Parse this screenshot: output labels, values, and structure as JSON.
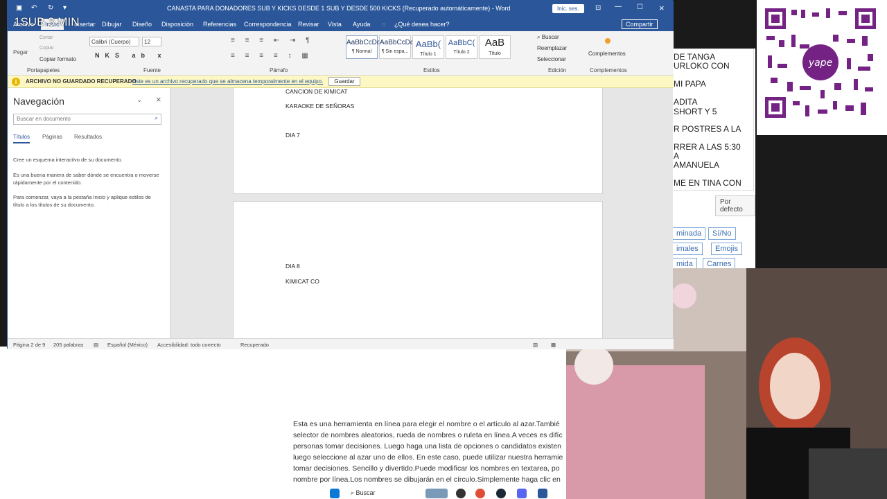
{
  "window": {
    "title": "CANASTA PARA DONADORES SUB Y KICKS DESDE 1 SUB Y DESDE 500 KICKS (Recuperado automáticamente) - Word",
    "signin": "Inic. ses.",
    "share": "Compartir"
  },
  "overlay": {
    "text": "1SUB 3 MIN"
  },
  "tabs": [
    "Archivo",
    "Inicio",
    "Insertar",
    "Dibujar",
    "Diseño",
    "Disposición",
    "Referencias",
    "Correspondencia",
    "Revisar",
    "Vista",
    "Ayuda"
  ],
  "tell_me": "¿Qué desea hacer?",
  "ribbon": {
    "clipboard": {
      "paste": "Pegar",
      "cut": "Cortar",
      "copy": "Copiar",
      "format_painter": "Copiar formato",
      "label": "Portapapeles"
    },
    "font": {
      "name": "Calibri (Cuerpo)",
      "size": "12",
      "label": "Fuente"
    },
    "paragraph": {
      "label": "Párrafo"
    },
    "styles": {
      "items": [
        {
          "preview": "AaBbCcDc",
          "name": "¶ Normal"
        },
        {
          "preview": "AaBbCcDc",
          "name": "¶ Sin espa..."
        },
        {
          "preview": "AaBb(",
          "name": "Título 1"
        },
        {
          "preview": "AaBbC(",
          "name": "Título 2"
        },
        {
          "preview": "AaB",
          "name": "Título"
        }
      ],
      "label": "Estilos"
    },
    "editing": {
      "find": "Buscar",
      "replace": "Reemplazar",
      "select": "Seleccionar",
      "label": "Edición"
    },
    "addins": {
      "button": "Complementos",
      "label": "Complementos"
    }
  },
  "infobar": {
    "heading": "ARCHIVO NO GUARDADO RECUPERADO",
    "message": "Este es un archivo recuperado que se almacena temporalmente en el equipo.",
    "save": "Guardar"
  },
  "nav": {
    "title": "Navegación",
    "search_placeholder": "Buscar en documento",
    "tabs": [
      "Títulos",
      "Páginas",
      "Resultados"
    ],
    "p1": "Cree un esquema interactivo de su documento.",
    "p2": "Es una buena manera de saber dónde se encuentra o moverse rápidamente por el contenido.",
    "p3": "Para comenzar, vaya a la pestaña Inicio y aplique estilos de título a los títulos de su documento."
  },
  "document": {
    "page1": [
      "CANCION DE KIMICAT",
      "KARAOKE DE SEÑORAS",
      "DIA 7"
    ],
    "page2": [
      "DIA 8",
      "KIMICAT CO"
    ]
  },
  "status": {
    "page": "Página 2 de 9",
    "words": "205 palabras",
    "language": "Español (México)",
    "accessibility": "Accesibilidad: todo correcto",
    "recovered": "Recuperado"
  },
  "background_list": [
    "DE TANGA",
    "URLOKO CON",
    "MI PAPA",
    "ADITA",
    "SHORT Y 5",
    "R  POSTRES A  LA",
    "RRER A LAS 5:30",
    "A",
    "AMANUELA",
    "ME EN TINA CON"
  ],
  "background_default": "Por defecto",
  "background_tags": [
    "minada",
    "Sí/No",
    "imales",
    "Emojis",
    "mida",
    "Carnes"
  ],
  "background_paragraph": [
    "Esta es una herramienta en línea para elegir el nombre o el artículo al azar.Tambié",
    "selector de nombres aleatorios, rueda de nombres o ruleta en línea.A veces es difíc",
    "personas tomar decisiones. Luego haga una lista de opciones o candidatos existen",
    "luego seleccione al azar uno de ellos. En este caso, puede utilizar nuestra herramie",
    "tomar decisiones. Sencillo y divertido.Puede modificar los nombres en textarea, po",
    "nombre por línea.Los nombres se dibujarán en el círculo.Simplemente haga clic en"
  ],
  "qr": {
    "brand": "yape"
  },
  "taskbar": {
    "search": "Buscar"
  },
  "colors": {
    "word_blue": "#2b579a",
    "info_yellow": "#fdf7c4",
    "yape_purple": "#742284"
  }
}
